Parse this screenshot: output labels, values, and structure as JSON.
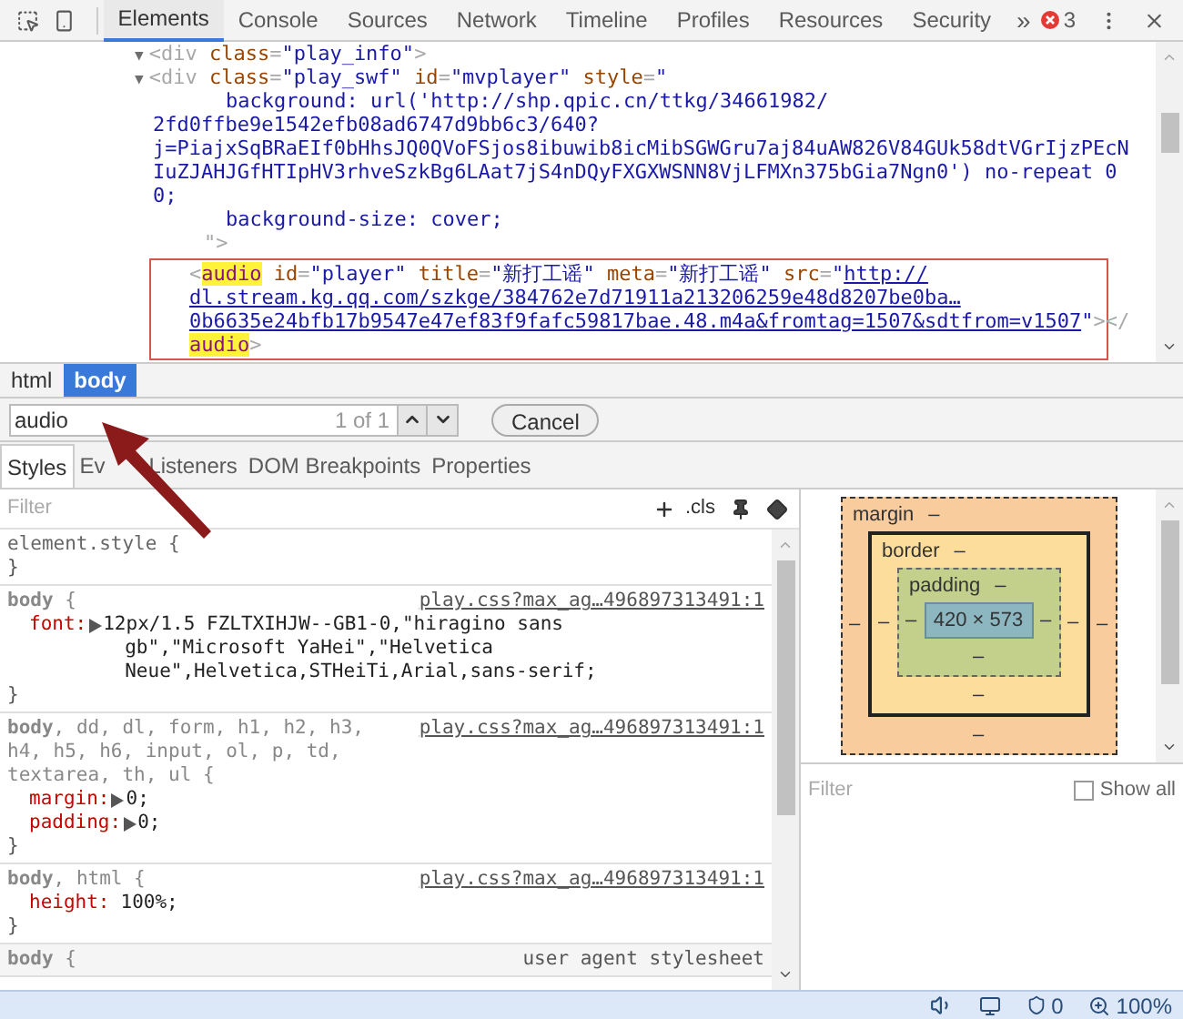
{
  "toolbar": {
    "tabs": [
      {
        "label": "Elements",
        "selected": true
      },
      {
        "label": "Console",
        "selected": false
      },
      {
        "label": "Sources",
        "selected": false
      },
      {
        "label": "Network",
        "selected": false
      },
      {
        "label": "Timeline",
        "selected": false
      },
      {
        "label": "Profiles",
        "selected": false
      },
      {
        "label": "Resources",
        "selected": false
      },
      {
        "label": "Security",
        "selected": false
      }
    ],
    "overflow": "»",
    "error_count": "3"
  },
  "dom_tree": {
    "lines": [
      {
        "kind": "node",
        "segments": [
          {
            "kind": "arrow",
            "t": "▼"
          },
          {
            "kind": "tag",
            "t": "<div "
          },
          {
            "kind": "attr",
            "t": "class"
          },
          {
            "kind": "tag",
            "t": "="
          },
          {
            "kind": "val",
            "t": "\"play_info\""
          },
          {
            "kind": "tag",
            "t": ">"
          }
        ]
      },
      {
        "kind": "node",
        "segments": [
          {
            "kind": "arrow",
            "t": "▼"
          },
          {
            "kind": "tag",
            "t": "<div "
          },
          {
            "kind": "attr",
            "t": "class"
          },
          {
            "kind": "tag",
            "t": "="
          },
          {
            "kind": "val",
            "t": "\"play_swf\" "
          },
          {
            "kind": "attr",
            "t": "id"
          },
          {
            "kind": "tag",
            "t": "="
          },
          {
            "kind": "val",
            "t": "\"mvplayer\" "
          },
          {
            "kind": "attr",
            "t": "style"
          },
          {
            "kind": "tag",
            "t": "="
          },
          {
            "kind": "val",
            "t": "\""
          }
        ]
      },
      {
        "kind": "style",
        "segments": [
          {
            "kind": "val",
            "t": "background: url('http://shp.qpic.cn/ttkg/34661982/"
          }
        ]
      },
      {
        "kind": "wrapped",
        "segments": [
          {
            "kind": "val",
            "t": "2fd0ffbe9e1542efb08ad6747d9bb6c3/640?"
          }
        ]
      },
      {
        "kind": "wrapped",
        "segments": [
          {
            "kind": "val",
            "t": "j=PiajxSqBRaEIf0bHhsJQ0QVoFSjos8ibuwib8icMibSGWGru7aj84uAW826V84GUk58dtVGrIjzPEcN"
          }
        ]
      },
      {
        "kind": "wrapped",
        "segments": [
          {
            "kind": "val",
            "t": "IuZJAHJGfHTIpHV3rhveSzkBg6LAat7jS4nDQyFXGXWSNN8VjLFMXn375bGia7Ngn0') no-repeat 0"
          }
        ]
      },
      {
        "kind": "wrapped",
        "segments": [
          {
            "kind": "val",
            "t": "0;"
          }
        ]
      },
      {
        "kind": "style",
        "segments": [
          {
            "kind": "val",
            "t": "background-size: cover;"
          }
        ]
      },
      {
        "kind": "closer",
        "segments": [
          {
            "kind": "tag",
            "t": "\">"
          }
        ]
      }
    ],
    "found_element": {
      "selected": true,
      "lines": [
        {
          "segments": [
            {
              "kind": "tag",
              "t": "<"
            },
            {
              "kind": "match",
              "t": "audio"
            },
            {
              "kind": "attr",
              "t": " id"
            },
            {
              "kind": "tag",
              "t": "="
            },
            {
              "kind": "val",
              "t": "\"player\" "
            },
            {
              "kind": "attr",
              "t": "title"
            },
            {
              "kind": "tag",
              "t": "="
            },
            {
              "kind": "val",
              "t": "\"新打工谣\" "
            },
            {
              "kind": "attr",
              "t": "meta"
            },
            {
              "kind": "tag",
              "t": "="
            },
            {
              "kind": "val",
              "t": "\"新打工谣\" "
            },
            {
              "kind": "attr",
              "t": "src"
            },
            {
              "kind": "tag",
              "t": "="
            },
            {
              "kind": "val",
              "t": "\""
            },
            {
              "kind": "link",
              "t": "http://"
            }
          ]
        },
        {
          "segments": [
            {
              "kind": "link",
              "t": "dl.stream.kg.qq.com/szkge/384762e7d71911a213206259e48d8207be0ba…"
            }
          ]
        },
        {
          "segments": [
            {
              "kind": "link",
              "t": "0b6635e24bfb17b9547e47ef83f9fafc59817bae.48.m4a&fromtag=1507&sdtfrom=v1507"
            },
            {
              "kind": "val",
              "t": "\""
            },
            {
              "kind": "tag",
              "t": "></"
            }
          ]
        },
        {
          "segments": [
            {
              "kind": "match",
              "t": "audio"
            },
            {
              "kind": "tag",
              "t": ">"
            }
          ]
        }
      ]
    }
  },
  "breadcrumbs": [
    {
      "label": "html",
      "selected": false
    },
    {
      "label": "body",
      "selected": true
    }
  ],
  "search": {
    "value": "audio",
    "count": "1 of 1",
    "cancel": "Cancel"
  },
  "panel_tabs": [
    {
      "label": "Styles",
      "selected": true
    },
    {
      "label": "Ev",
      "label_after": "Listeners",
      "selected": false
    },
    {
      "label": "DOM Breakpoints",
      "selected": false
    },
    {
      "label": "Properties",
      "selected": false
    }
  ],
  "styles": {
    "filter_placeholder": "Filter",
    "cls": ".cls",
    "rules": [
      {
        "kind": "inline",
        "selector": "element.style {",
        "close": "}"
      },
      {
        "kind": "file",
        "source": "play.css?max_ag…496897313491:1",
        "selector": "**body** {",
        "properties": [
          {
            "name": "font:",
            "value": "12px/1.5 FZLTXIHJW--GB1-0,\"hiragino sans gb\",\"Microsoft YaHei\",\"Helvetica Neue\",Helvetica,STHeiTi,Arial,sans-serif;",
            "expandable": true
          }
        ],
        "close": "}"
      },
      {
        "kind": "file",
        "source": "play.css?max_ag…496897313491:1",
        "selector": "**body**, dd, dl, form, h1, h2, h3, h4, h5, h6, input, ol, p, td, textarea, th, ul {",
        "properties": [
          {
            "name": "margin:",
            "value": "0;",
            "expandable": true
          },
          {
            "name": "padding:",
            "value": "0;",
            "expandable": true
          }
        ],
        "close": "}"
      },
      {
        "kind": "file",
        "source": "play.css?max_ag…496897313491:1",
        "selector": "**body**, html {",
        "properties": [
          {
            "name": "height:",
            "value": "100%;",
            "expandable": false
          }
        ],
        "close": "}"
      },
      {
        "kind": "user_agent",
        "source": "user agent stylesheet",
        "selector": "**body** {"
      }
    ]
  },
  "box_model": {
    "margin": {
      "label": "margin",
      "top": "–",
      "right": "–",
      "bottom": "–",
      "left": "–"
    },
    "border": {
      "label": "border",
      "top": "–",
      "right": "–",
      "bottom": "–",
      "left": "–"
    },
    "padding": {
      "label": "padding",
      "top": "–",
      "right": "–",
      "bottom": "–",
      "left": "–"
    },
    "content": "420 × 573"
  },
  "computed": {
    "filter_placeholder": "Filter",
    "show_all": {
      "label": "Show all",
      "checked": false
    }
  },
  "status_bar": {
    "blocked_count": "0",
    "zoom": "100%"
  }
}
